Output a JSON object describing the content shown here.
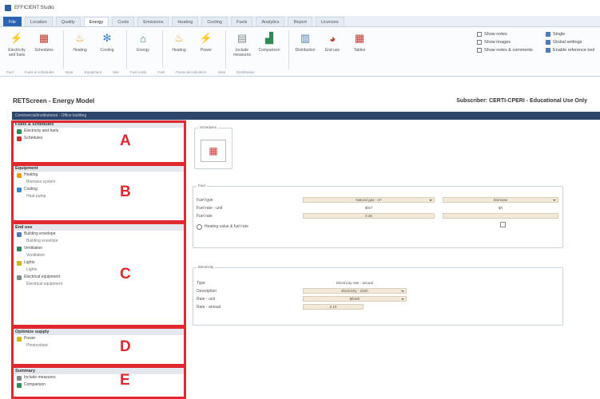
{
  "window": {
    "title": "EFFICIENT Studio"
  },
  "tabs": [
    "File",
    "Location",
    "Quality",
    "Energy",
    "Costs",
    "Emissions",
    "Heating",
    "Cooling",
    "Fuels",
    "Analytics",
    "Report",
    "Licenses"
  ],
  "active_tab": "Energy",
  "ribbon": {
    "buttons": [
      {
        "label": "Electricity and fuels",
        "icon": "electricity-icon",
        "color": "#3a8a3a"
      },
      {
        "label": "Schedules",
        "icon": "calendar-icon",
        "color": "#c0392b"
      },
      {
        "label": "Heating",
        "icon": "flame-icon",
        "color": "#e6a11a"
      },
      {
        "label": "Cooling",
        "icon": "snowflake-icon",
        "color": "#3a86c9"
      },
      {
        "label": "Energy",
        "icon": "house-icon",
        "color": "#2f8a55"
      },
      {
        "label": "Heating",
        "icon": "flame-icon",
        "color": "#e6a11a"
      },
      {
        "label": "Power",
        "icon": "power-icon",
        "color": "#d4b21a"
      },
      {
        "label": "Include measures",
        "icon": "document-icon",
        "color": "#7f8c8d"
      },
      {
        "label": "Comparison",
        "icon": "factory-icon",
        "color": "#2f8a55"
      },
      {
        "label": "Distribution",
        "icon": "chart-icon",
        "color": "#4d7bb8"
      },
      {
        "label": "End use",
        "icon": "pie-icon",
        "color": "#c0392b"
      },
      {
        "label": "Tables",
        "icon": "table-icon",
        "color": "#c0392b"
      }
    ],
    "group_labels": [
      "Fuel",
      "Fuels & schedules",
      "Input",
      "Equipment",
      "Site",
      "Fuel costs",
      "Fuel",
      "Financial indicators",
      "Heat",
      "Distribution"
    ],
    "right_options": [
      {
        "label": "Show notes",
        "checked": false
      },
      {
        "label": "Show images",
        "checked": false
      },
      {
        "label": "Show notes & comments",
        "checked": false
      }
    ],
    "right_actions": [
      "Single",
      "Global settings",
      "Enable reference tool"
    ]
  },
  "header": {
    "page_title": "RETScreen - Energy Model",
    "subscription": "Subscriber: CERTI-CPERI - Educational Use Only"
  },
  "bluebar": {
    "text": "Commercial/institutional - Office building"
  },
  "sidebar": {
    "sections": [
      {
        "title": "Fuels & schedules",
        "items": [
          {
            "label": "Electricity and fuels",
            "sub": false
          },
          {
            "label": "Schedules",
            "sub": false
          }
        ]
      },
      {
        "title": "Equipment",
        "items": [
          {
            "label": "Heating",
            "sub": false
          },
          {
            "label": "Biomass system",
            "sub": true
          },
          {
            "label": "Cooling",
            "sub": false
          },
          {
            "label": "Heat pump",
            "sub": true
          }
        ]
      },
      {
        "title": "End use",
        "items": [
          {
            "label": "Building envelope",
            "sub": false
          },
          {
            "label": "Building envelope",
            "sub": true
          },
          {
            "label": "Ventilation",
            "sub": false
          },
          {
            "label": "Ventilation",
            "sub": true
          },
          {
            "label": "Lights",
            "sub": false
          },
          {
            "label": "Lights",
            "sub": true
          },
          {
            "label": "Electrical equipment",
            "sub": false
          },
          {
            "label": "Electrical equipment",
            "sub": true
          }
        ]
      },
      {
        "title": "Optimize supply",
        "items": [
          {
            "label": "Power",
            "sub": false
          },
          {
            "label": "Photovoltaic",
            "sub": true
          }
        ]
      },
      {
        "title": "Summary",
        "items": [
          {
            "label": "Include measures",
            "sub": false
          },
          {
            "label": "Comparison",
            "sub": false
          }
        ]
      }
    ],
    "callouts": [
      "A",
      "B",
      "C",
      "D",
      "E"
    ]
  },
  "content": {
    "schedule_box": {
      "title": "Schedules"
    },
    "fuel_box": {
      "title": "Fuel",
      "rows": [
        {
          "label": "Fuel type",
          "value1": "Natural gas - m³",
          "value2": "Biomass"
        },
        {
          "label": "Fuel rate - unit",
          "value1": "$/m³",
          "value2": "$/t"
        },
        {
          "label": "Fuel rate",
          "value1": "0.35",
          "value2": ""
        }
      ],
      "checkbox_label": "Heating value & fuel rate"
    },
    "electricity_box": {
      "title": "Electricity",
      "rows": [
        {
          "label": "Type",
          "value": "Electricity rate - annual"
        },
        {
          "label": "Description",
          "value": "Electricity - 2000"
        },
        {
          "label": "Rate - unit",
          "value": "$/kWh"
        },
        {
          "label": "Rate - annual",
          "value": "0.10"
        }
      ]
    }
  },
  "colors": {
    "accent": "#2b64b2",
    "callout": "#e0282e",
    "bluebar": "#2e456b",
    "field": "#f2e9d8"
  }
}
